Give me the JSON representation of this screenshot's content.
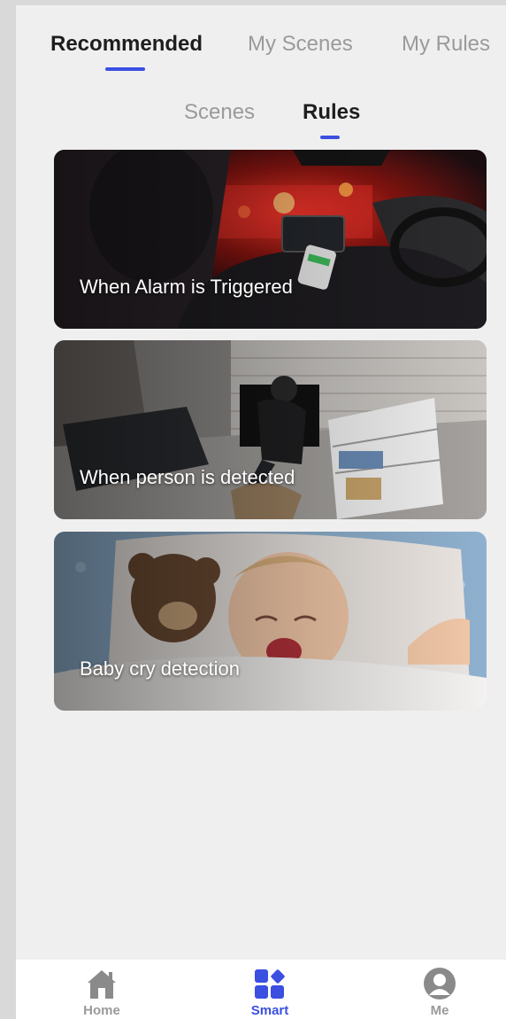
{
  "top_tabs": {
    "recommended": "Recommended",
    "my_scenes": "My Scenes",
    "my_rules": "My Rules",
    "active": "recommended"
  },
  "sub_tabs": {
    "scenes": "Scenes",
    "rules": "Rules",
    "active": "rules"
  },
  "cards": [
    {
      "title": "When Alarm is Triggered"
    },
    {
      "title": "When person is detected"
    },
    {
      "title": "Baby cry detection"
    }
  ],
  "bottom_nav": {
    "home": "Home",
    "smart": "Smart",
    "me": "Me",
    "active": "smart"
  },
  "colors": {
    "accent": "#3b4fe0",
    "inactive_text": "#9a9a9a",
    "active_text": "#1e1e1e",
    "background": "#efefef"
  }
}
